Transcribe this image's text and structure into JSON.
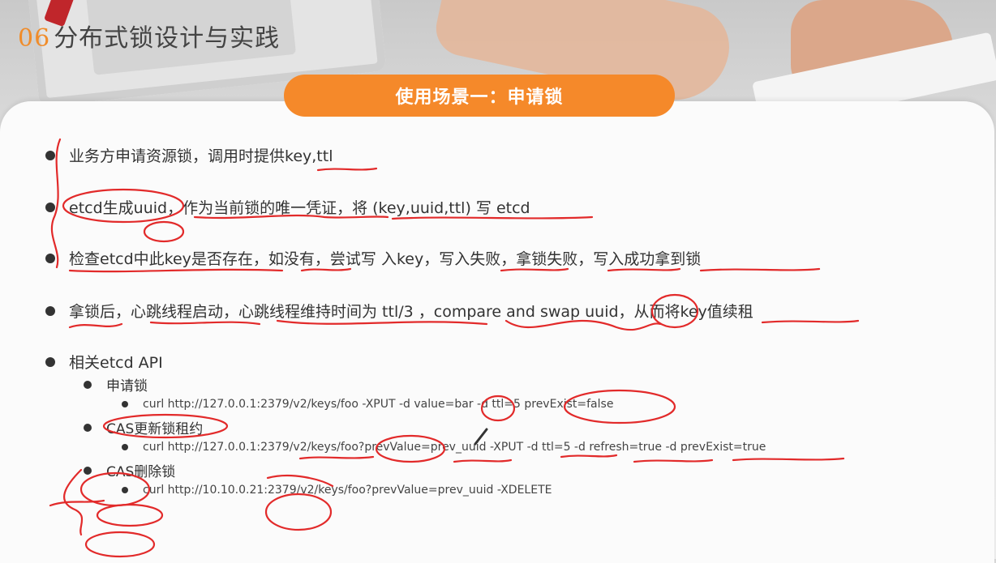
{
  "header": {
    "section_number": "06",
    "section_title": "分布式锁设计与实践"
  },
  "banner": {
    "label": "使用场景一：申请锁"
  },
  "bullets": [
    "业务方申请资源锁，调用时提供key,ttl",
    "etcd生成uuid，作为当前锁的唯一凭证，将 (key,uuid,ttl) 写 etcd",
    "检查etcd中此key是否存在，如没有，尝试写 入key，写入失败，拿锁失败，写入成功拿到锁",
    "拿锁后，心跳线程启动，心跳线程维持时间为 ttl/3 ，compare and swap uuid，从而将key值续租",
    "相关etcd API"
  ],
  "api": [
    {
      "name": "申请锁",
      "command": "curl http://127.0.0.1:2379/v2/keys/foo -XPUT -d value=bar -d ttl=5 prevExist=false"
    },
    {
      "name": "CAS更新锁租约",
      "command": "curl http://127.0.0.1:2379/v2/keys/foo?prevValue=prev_uuid -XPUT -d ttl=5 -d refresh=true -d prevExist=true"
    },
    {
      "name": "CAS删除锁",
      "command": "curl http://10.10.0.21:2379/v2/keys/foo?prevValue=prev_uuid -XDELETE"
    }
  ],
  "colors": {
    "accent": "#f5892a",
    "annotation": "#e22a2a",
    "number": "#f08c2a"
  }
}
